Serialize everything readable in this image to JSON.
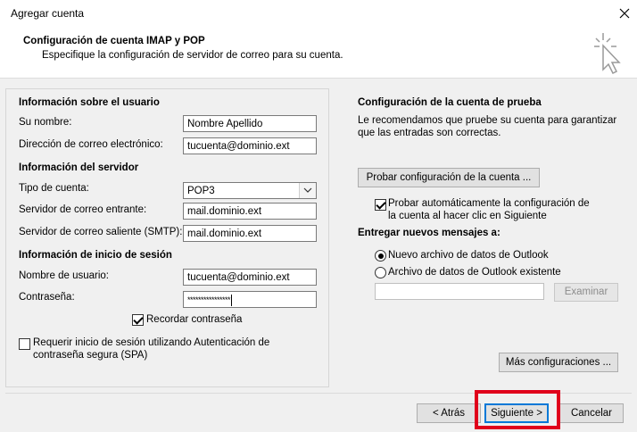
{
  "window": {
    "title": "Agregar cuenta"
  },
  "header": {
    "title": "Configuración de cuenta IMAP y POP",
    "subtitle": "Especifique la configuración de servidor de correo para su cuenta."
  },
  "user_info": {
    "heading": "Información sobre el usuario",
    "name_label": "Su nombre:",
    "name_value": "Nombre Apellido",
    "email_label": "Dirección de correo electrónico:",
    "email_value": "tucuenta@dominio.ext"
  },
  "server_info": {
    "heading": "Información del servidor",
    "type_label": "Tipo de cuenta:",
    "type_value": "POP3",
    "incoming_label": "Servidor de correo entrante:",
    "incoming_value": "mail.dominio.ext",
    "outgoing_label": "Servidor de correo saliente (SMTP):",
    "outgoing_value": "mail.dominio.ext"
  },
  "login_info": {
    "heading": "Información de inicio de sesión",
    "user_label": "Nombre de usuario:",
    "user_value": "tucuenta@dominio.ext",
    "password_label": "Contraseña:",
    "password_value": "****************",
    "remember_label": "Recordar contraseña",
    "remember_checked": true,
    "spa_label_line1": "Requerir inicio de sesión utilizando Autenticación de",
    "spa_label_line2": "contraseña segura (SPA)",
    "spa_checked": false
  },
  "test_settings": {
    "heading": "Configuración de la cuenta de prueba",
    "desc_line1": "Le recomendamos que pruebe su cuenta para garantizar",
    "desc_line2": "que las entradas son correctas.",
    "test_button": "Probar configuración de la cuenta ...",
    "auto_test_line1": "Probar automáticamente la configuración de",
    "auto_test_line2": "la cuenta al hacer clic en Siguiente",
    "auto_test_checked": true
  },
  "delivery": {
    "heading": "Entregar nuevos mensajes a:",
    "option_new": "Nuevo archivo de datos de Outlook",
    "option_existing": "Archivo de datos de Outlook existente",
    "selected": "new",
    "path_value": "",
    "browse_button": "Examinar"
  },
  "more_settings_button": "Más configuraciones ...",
  "footer": {
    "back": "< Atrás",
    "next": "Siguiente >",
    "cancel": "Cancelar"
  },
  "colors": {
    "highlight": "#e0001b",
    "accent": "#0078d7",
    "panel": "#f0f0f0"
  },
  "icons": {
    "close": "close-icon",
    "wizard": "cursor-sparkle-icon",
    "dropdown": "chevron-down-icon"
  }
}
